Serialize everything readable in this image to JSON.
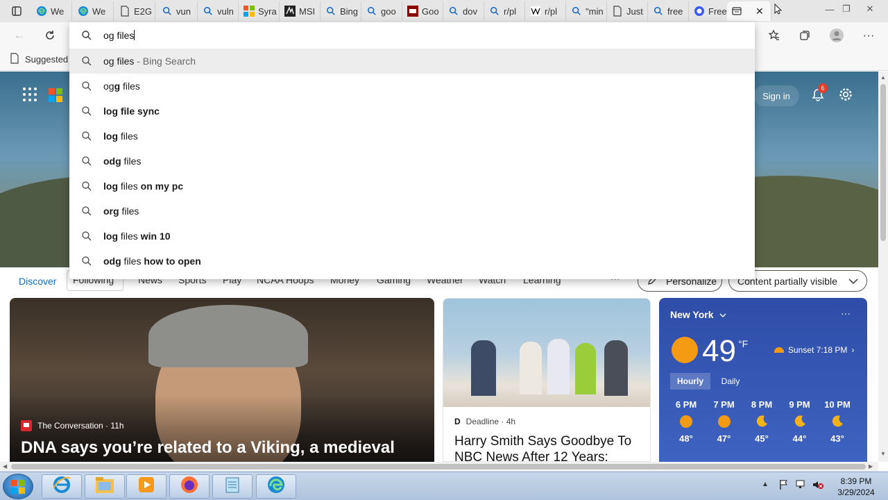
{
  "tabs": [
    {
      "icon": "edge-icon",
      "label": "We"
    },
    {
      "icon": "edge-icon",
      "label": "We"
    },
    {
      "icon": "page-icon",
      "label": "E2G"
    },
    {
      "icon": "search-icon",
      "label": "vun"
    },
    {
      "icon": "search-icon",
      "label": "vuln"
    },
    {
      "icon": "microsoft-logo-icon",
      "label": "Syra"
    },
    {
      "icon": "msi-icon",
      "label": "MSI"
    },
    {
      "icon": "search-icon",
      "label": "Bing"
    },
    {
      "icon": "search-icon",
      "label": "goo"
    },
    {
      "icon": "ms-red-icon",
      "label": "Goo"
    },
    {
      "icon": "search-icon",
      "label": "dov"
    },
    {
      "icon": "search-icon",
      "label": "r/pl"
    },
    {
      "icon": "wikipedia-icon",
      "label": "r/pl"
    },
    {
      "icon": "search-icon",
      "label": "\"min"
    },
    {
      "icon": "page-icon",
      "label": "Just"
    },
    {
      "icon": "search-icon",
      "label": "free"
    },
    {
      "icon": "copilot-icon",
      "label": "Free"
    }
  ],
  "omnibox": {
    "query": "og files",
    "suggestions": [
      {
        "parts": [
          {
            "t": "og files",
            "b": false
          },
          {
            "t": " - Bing Search",
            "b": false,
            "muted": true
          }
        ]
      },
      {
        "parts": [
          {
            "t": "og",
            "b": false
          },
          {
            "t": "g",
            "b": true
          },
          {
            "t": " files",
            "b": false
          }
        ]
      },
      {
        "parts": [
          {
            "t": "log file sync",
            "b": true
          }
        ]
      },
      {
        "parts": [
          {
            "t": "log",
            "b": true
          },
          {
            "t": " files",
            "b": false
          }
        ]
      },
      {
        "parts": [
          {
            "t": "odg",
            "b": true
          },
          {
            "t": " files",
            "b": false
          }
        ]
      },
      {
        "parts": [
          {
            "t": "log",
            "b": true
          },
          {
            "t": " files",
            "b": false
          },
          {
            "t": " on my pc",
            "b": true
          }
        ]
      },
      {
        "parts": [
          {
            "t": "org",
            "b": true
          },
          {
            "t": " files",
            "b": false
          }
        ]
      },
      {
        "parts": [
          {
            "t": "log",
            "b": true
          },
          {
            "t": " files",
            "b": false
          },
          {
            "t": " win 10",
            "b": true
          }
        ]
      },
      {
        "parts": [
          {
            "t": "odg",
            "b": true
          },
          {
            "t": " files",
            "b": false
          },
          {
            "t": " how to open",
            "b": true
          }
        ]
      }
    ]
  },
  "favorites": {
    "suggested_label": "Suggested"
  },
  "header": {
    "sign_in": "Sign in",
    "notification_count": "6"
  },
  "nav": {
    "items": [
      "Discover",
      "Following",
      "News",
      "Sports",
      "Play",
      "NCAA Hoops",
      "Money",
      "Gaming",
      "Weather",
      "Watch",
      "Learning"
    ],
    "more": "···",
    "personalize": "Personalize",
    "content_filter": "Content partially visible"
  },
  "cards": {
    "main": {
      "source": "The Conversation · 11h",
      "headline": "DNA says you’re related to a Viking, a medieval"
    },
    "second": {
      "source_logo": "D",
      "source": "Deadline · 4h",
      "headline": "Harry Smith Says Goodbye To NBC News After 12 Years:"
    }
  },
  "weather": {
    "city": "New York",
    "temp": "49",
    "unit": "°F",
    "sunset": "Sunset 7:18 PM",
    "tabs": [
      "Hourly",
      "Daily"
    ],
    "more": "···",
    "hours": [
      {
        "time": "6 PM",
        "icon": "sun-icon",
        "temp": "48°"
      },
      {
        "time": "7 PM",
        "icon": "sun-icon",
        "temp": "47°"
      },
      {
        "time": "8 PM",
        "icon": "moon-icon",
        "temp": "45°"
      },
      {
        "time": "9 PM",
        "icon": "moon-icon",
        "temp": "44°"
      },
      {
        "time": "10 PM",
        "icon": "moon-icon",
        "temp": "43°"
      }
    ]
  },
  "taskbar": {
    "apps": [
      "internet-explorer-icon",
      "file-explorer-icon",
      "media-player-icon",
      "firefox-icon",
      "notepad-icon",
      "edge-icon"
    ],
    "time": "8:39 PM",
    "date": "3/29/2024"
  },
  "colors": {
    "accent": "#0f6cbd",
    "weather_bg": "#3e63c0",
    "sun": "#f59a13"
  }
}
